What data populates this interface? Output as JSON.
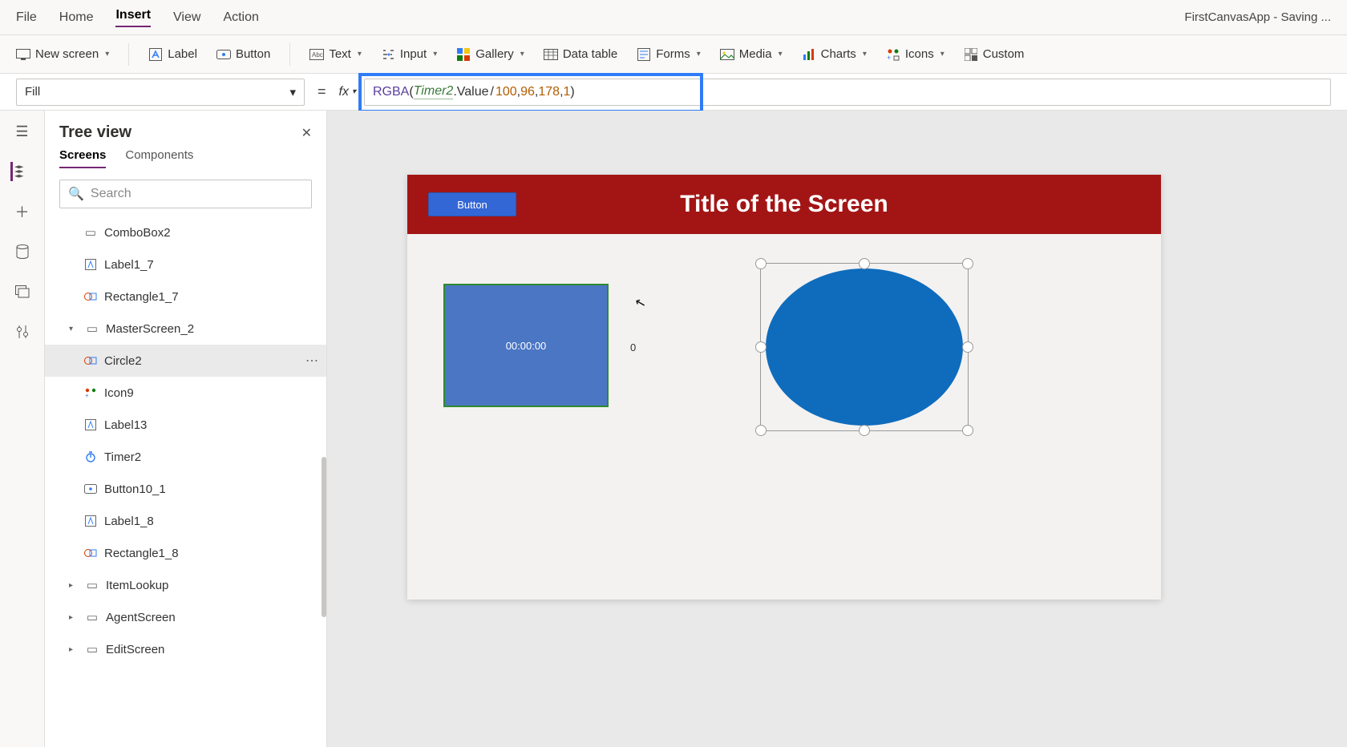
{
  "app": {
    "status": "FirstCanvasApp - Saving ..."
  },
  "menu": {
    "file": "File",
    "home": "Home",
    "insert": "Insert",
    "view": "View",
    "action": "Action"
  },
  "ribbon": {
    "newscreen": "New screen",
    "label": "Label",
    "button": "Button",
    "text": "Text",
    "input": "Input",
    "gallery": "Gallery",
    "datatable": "Data table",
    "forms": "Forms",
    "media": "Media",
    "charts": "Charts",
    "icons": "Icons",
    "custom": "Custom"
  },
  "formula": {
    "property": "Fill",
    "operator": "=",
    "fx": "fx",
    "fn": "RGBA",
    "open": "(",
    "id": "Timer2",
    "dot": ".",
    "prop": "Value",
    "div": " / ",
    "n1": "100",
    "c1": ", ",
    "n2": "96",
    "c2": ", ",
    "n3": "178",
    "c3": ", ",
    "n4": "1",
    "close": ")"
  },
  "treepane": {
    "title": "Tree view",
    "tabScreens": "Screens",
    "tabComponents": "Components",
    "searchPlaceholder": "Search"
  },
  "tree": {
    "combobox": "ComboBox2",
    "label1_7": "Label1_7",
    "rect1_7": "Rectangle1_7",
    "master": "MasterScreen_2",
    "circle2": "Circle2",
    "icon9": "Icon9",
    "label13": "Label13",
    "timer2": "Timer2",
    "button10_1": "Button10_1",
    "label1_8": "Label1_8",
    "rect1_8": "Rectangle1_8",
    "itemlookup": "ItemLookup",
    "agentscreen": "AgentScreen",
    "editscreen": "EditScreen"
  },
  "canvas": {
    "title": "Title of the Screen",
    "button": "Button",
    "timer": "00:00:00",
    "timerLabel": "0"
  }
}
